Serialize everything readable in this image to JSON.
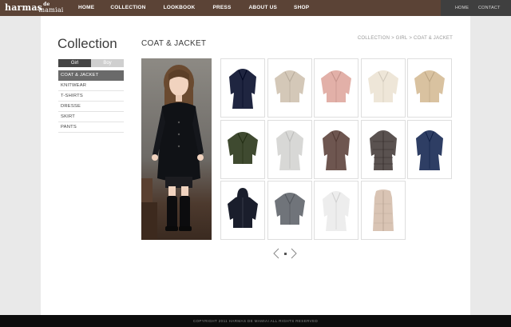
{
  "brand": {
    "logo_main": "harmas",
    "logo_de": "de",
    "logo_sub": "mamiai"
  },
  "nav": {
    "items": [
      "HOME",
      "COLLECTION",
      "LOOKBOOK",
      "PRESS",
      "ABOUT US",
      "SHOP"
    ]
  },
  "util": {
    "home": "HOME",
    "contact": "CONTACT"
  },
  "page": {
    "title": "Collection",
    "section_title": "COAT & JACKET",
    "breadcrumb": [
      "COLLECTION",
      "GIRL",
      "COAT & JACKET"
    ],
    "breadcrumb_sep": ">"
  },
  "toggle": {
    "girl": "Girl",
    "boy": "Boy",
    "selected": "Girl"
  },
  "categories": [
    "COAT & JACKET",
    "KNITWEAR",
    "T-SHIRTS",
    "DRESSE",
    "SKIRT",
    "PANTS"
  ],
  "active_category": "COAT & JACKET",
  "products": [
    {
      "icon": "coat-icon",
      "color": "#1f2540"
    },
    {
      "icon": "jacket-icon",
      "color": "#d4c8b8"
    },
    {
      "icon": "jacket-icon",
      "color": "#e2b0a8"
    },
    {
      "icon": "jacket-icon",
      "color": "#eee6d8"
    },
    {
      "icon": "jacket-icon",
      "color": "#d9c2a0"
    },
    {
      "icon": "jacket-icon",
      "color": "#3f4a30"
    },
    {
      "icon": "coat-icon",
      "color": "#d8d8d6"
    },
    {
      "icon": "coat-icon",
      "color": "#6e5650"
    },
    {
      "icon": "puffer-coat-icon",
      "color": "#5a5250"
    },
    {
      "icon": "coat-icon",
      "color": "#2e3e64"
    },
    {
      "icon": "hooded-jacket-icon",
      "color": "#1a1e2c"
    },
    {
      "icon": "jacket-icon",
      "color": "#70747a"
    },
    {
      "icon": "coat-icon",
      "color": "#ededed"
    },
    {
      "icon": "vest-icon",
      "color": "#d9c4b4"
    }
  ],
  "pager": {
    "prev_icon": "chevron-left-icon",
    "next_icon": "chevron-right-icon"
  },
  "footer": {
    "copyright": "COPYRIGHT 2011 HARMAS DE MAMIAI ALL RIGHTS RESERVED"
  },
  "colors": {
    "topbar": "#5b4336",
    "utilbar": "#3f3f3f",
    "footer": "#0d0d0d",
    "active_category": "#6a6a6a"
  }
}
